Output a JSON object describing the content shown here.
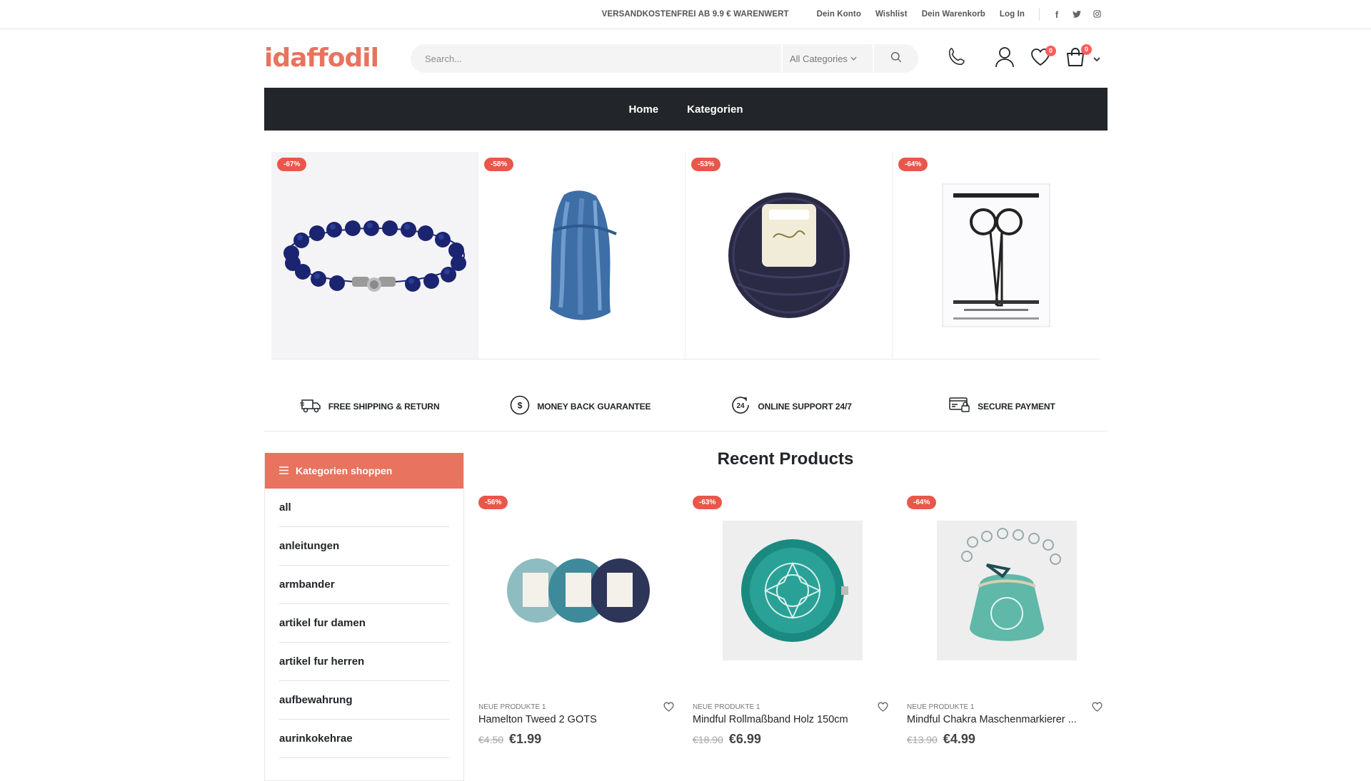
{
  "topbar": {
    "notice": "VERSANDKOSTENFREI AB 9.9 € WARENWERT",
    "links": [
      "Dein Konto",
      "Wishlist",
      "Dein Warenkorb",
      "Log In"
    ],
    "social": [
      "facebook-icon",
      "twitter-icon",
      "instagram-icon"
    ]
  },
  "header": {
    "logo": "idaffodil",
    "search_placeholder": "Search...",
    "category_select": "All Categories",
    "wishlist_count": "0",
    "cart_count": "0"
  },
  "nav": {
    "items": [
      "Home",
      "Kategorien"
    ]
  },
  "carousel": {
    "slides": [
      {
        "discount": "-67%",
        "image": "lapis-bracelet"
      },
      {
        "discount": "-58%",
        "image": "blue-yarn-skein"
      },
      {
        "discount": "-53%",
        "image": "navy-yarn-ball"
      },
      {
        "discount": "-64%",
        "image": "wide-bow-scissors-card"
      }
    ]
  },
  "features": [
    {
      "icon": "truck-icon",
      "label": "FREE SHIPPING & RETURN"
    },
    {
      "icon": "dollar-icon",
      "label": "MONEY BACK GUARANTEE"
    },
    {
      "icon": "support-24-icon",
      "label": "ONLINE SUPPORT 24/7"
    },
    {
      "icon": "card-icon",
      "label": "SECURE PAYMENT"
    }
  ],
  "sidebar": {
    "title": "Kategorien shoppen",
    "items": [
      "all",
      "anleitungen",
      "armbander",
      "artikel fur damen",
      "artikel fur herren",
      "aufbewahrung",
      "aurinkokehrae"
    ]
  },
  "recent": {
    "title": "Recent Products",
    "products": [
      {
        "discount": "-56%",
        "category": "NEUE PRODUKTE 1",
        "name": "Hamelton Tweed 2 GOTS",
        "old_price": "€4.50",
        "price": "€1.99"
      },
      {
        "discount": "-63%",
        "category": "NEUE PRODUKTE 1",
        "name": "Mindful Rollmaßband Holz 150cm",
        "old_price": "€18.90",
        "price": "€6.99"
      },
      {
        "discount": "-64%",
        "category": "NEUE PRODUKTE 1",
        "name": "Mindful Chakra Maschenmarkierer ...",
        "old_price": "€13.90",
        "price": "€4.99"
      }
    ]
  }
}
